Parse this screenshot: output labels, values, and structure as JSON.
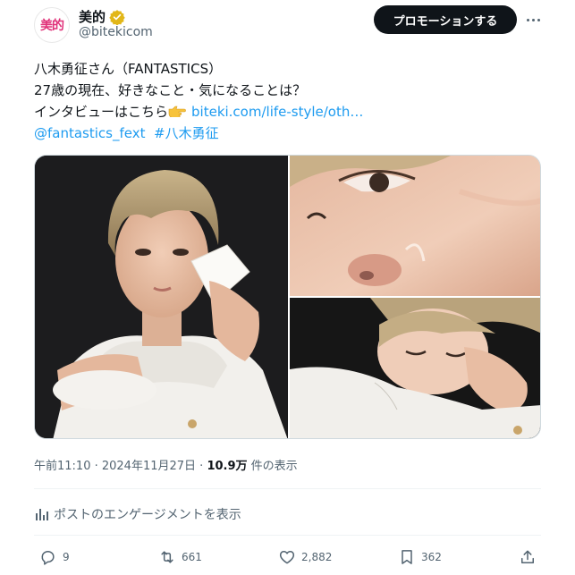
{
  "author": {
    "avatar_text": "美的",
    "display_name": "美的",
    "handle": "@bitekicom",
    "verified_icon": "gold-verified-badge-icon"
  },
  "header": {
    "promote_label": "プロモーションする",
    "more_icon": "more-options-icon"
  },
  "post": {
    "line1": "八木勇征さん（FANTASTICS）",
    "line2": "27歳の現在、好きなこと・気になることは？",
    "line3_prefix": "インタビューはこちら",
    "line3_emoji": "pointing-right-hand-emoji",
    "link_text": "biteki.com/life-style/oth…",
    "mention": "@fantastics_fext",
    "hashtag": "#八木勇征"
  },
  "meta": {
    "timestamp": "午前11:10 · 2024年11月27日 · ",
    "views_count": "10.9万",
    "views_label": " 件の表示"
  },
  "engagement": {
    "label": "ポストのエンゲージメントを表示",
    "icon": "bar-chart-icon"
  },
  "actions": {
    "replies": "9",
    "reposts": "661",
    "likes": "2,882",
    "bookmarks": "362"
  },
  "colors": {
    "link": "#1d9bf0",
    "text": "#0f1419",
    "muted": "#536471",
    "brand": "#e0327a",
    "verified": "#e2b719"
  }
}
